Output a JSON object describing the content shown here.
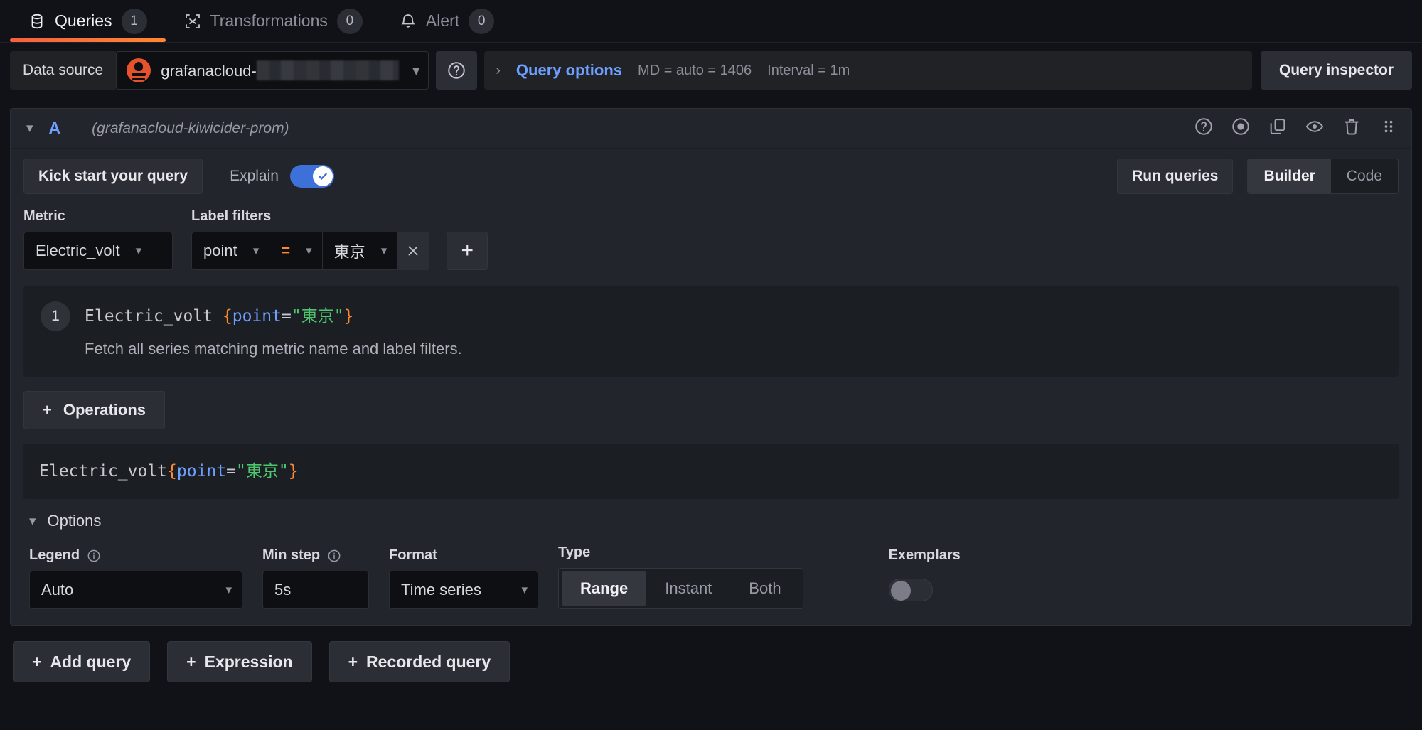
{
  "tabs": [
    {
      "label": "Queries",
      "count": "1",
      "icon": "database-icon",
      "active": true
    },
    {
      "label": "Transformations",
      "count": "0",
      "icon": "transformations-icon",
      "active": false
    },
    {
      "label": "Alert",
      "count": "0",
      "icon": "bell-icon",
      "active": false
    }
  ],
  "datasource_row": {
    "label": "Data source",
    "name_prefix": "grafanacloud-",
    "name_redacted": true,
    "help_icon": "help-circle-icon",
    "query_options": {
      "caret": "›",
      "title": "Query options",
      "max_data_points": "MD = auto = 1406",
      "interval": "Interval = 1m"
    },
    "query_inspector_label": "Query inspector"
  },
  "query": {
    "ref_id": "A",
    "datasource_name": "(grafanacloud-kiwicider-prom)",
    "actions": [
      "help-circle-icon",
      "target-circle-icon",
      "copy-icon",
      "eye-icon",
      "trash-icon",
      "drag-handle-icon"
    ],
    "kick_start_label": "Kick start your query",
    "explain_label": "Explain",
    "explain_enabled": true,
    "run_queries_label": "Run queries",
    "mode_options": [
      {
        "label": "Builder",
        "selected": true
      },
      {
        "label": "Code",
        "selected": false
      }
    ],
    "builder": {
      "metric_label": "Metric",
      "metric_value": "Electric_volt",
      "label_filters_label": "Label filters",
      "filter_key": "point",
      "filter_op": "=",
      "filter_value": "東京",
      "remove_filter_icon": "close-icon",
      "add_filter_label": "+"
    },
    "explain_block": {
      "step": "1",
      "code_metric": "Electric_volt",
      "code_open_brace": "{",
      "code_label": "point",
      "code_eq": "=",
      "code_value": "\"東京\"",
      "code_close_brace": "}",
      "description": "Fetch all series matching metric name and label filters."
    },
    "operations_label": "Operations",
    "preview": {
      "metric": "Electric_volt",
      "open_brace": "{",
      "label": "point",
      "eq": "=",
      "value": "\"東京\"",
      "close_brace": "}"
    },
    "options": {
      "title": "Options",
      "legend_label": "Legend",
      "legend_value": "Auto",
      "min_step_label": "Min step",
      "min_step_value": "5s",
      "format_label": "Format",
      "format_value": "Time series",
      "type_label": "Type",
      "type_options": [
        {
          "label": "Range",
          "selected": true
        },
        {
          "label": "Instant",
          "selected": false
        },
        {
          "label": "Both",
          "selected": false
        }
      ],
      "exemplars_label": "Exemplars",
      "exemplars_enabled": false
    }
  },
  "bottom_actions": [
    {
      "label": "Add query",
      "icon": "plus-icon"
    },
    {
      "label": "Expression",
      "icon": "plus-icon"
    },
    {
      "label": "Recorded query",
      "icon": "plus-icon"
    }
  ],
  "colors": {
    "accent_orange": "#f55f3e",
    "link_blue": "#6e9fff",
    "toggle_on_blue": "#3d71d9",
    "string_green": "#4ec76e",
    "brace_orange": "#ff8833",
    "panel_bg": "#22252b",
    "page_bg": "#111217"
  }
}
